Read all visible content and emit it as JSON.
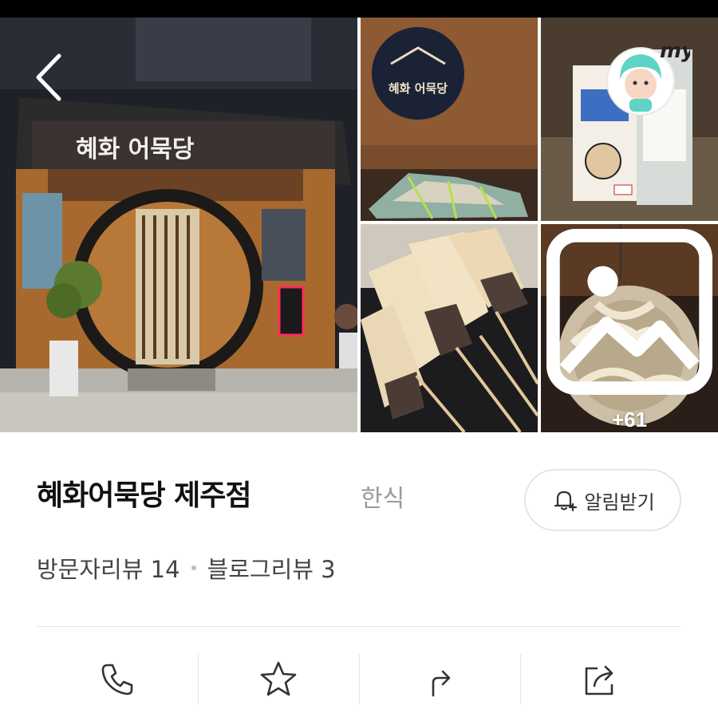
{
  "gallery": {
    "photo_labels": {
      "main": "혜화 어묵당",
      "sign": "혜화 어묵당"
    },
    "more_count": "+61",
    "my_badge_label": "my"
  },
  "place": {
    "name": "혜화어묵당 제주점",
    "category": "한식",
    "notify_label": "알림받기"
  },
  "reviews": {
    "visitor": "방문자리뷰 14",
    "blog": "블로그리뷰 3"
  },
  "actions": [
    {
      "icon": "phone-icon"
    },
    {
      "icon": "star-icon"
    },
    {
      "icon": "directions-icon"
    },
    {
      "icon": "share-icon"
    }
  ],
  "colors": {
    "text_primary": "#111111",
    "text_muted": "#9a9a9a",
    "divider": "#e6e6e6",
    "accent_teal": "#5fd3c6"
  }
}
